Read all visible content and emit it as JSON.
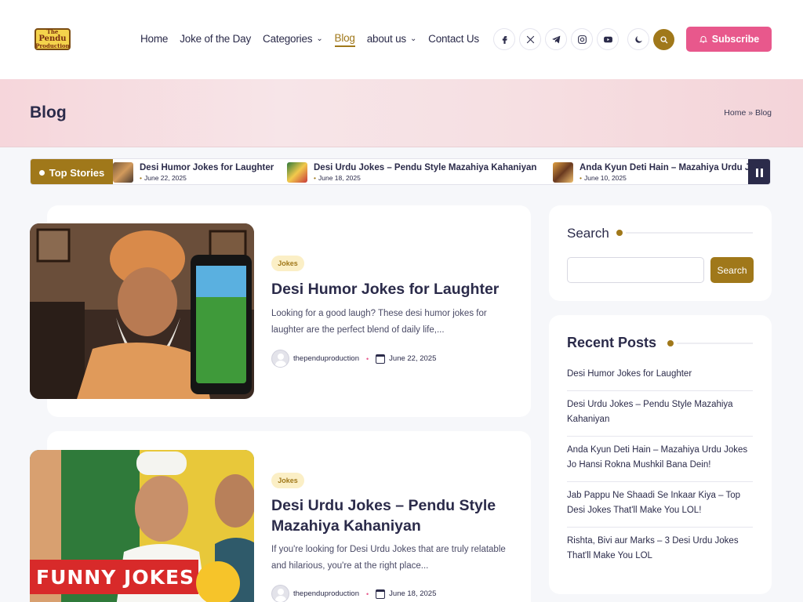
{
  "site": {
    "logo_lines": [
      "The",
      "Pendu",
      "Production"
    ]
  },
  "nav": {
    "items": [
      {
        "label": "Home"
      },
      {
        "label": "Joke of the Day"
      },
      {
        "label": "Categories",
        "dropdown": true
      },
      {
        "label": "Blog",
        "active": true
      },
      {
        "label": "about us",
        "dropdown": true
      },
      {
        "label": "Contact Us"
      }
    ],
    "social_icons": [
      "facebook-icon",
      "x-icon",
      "telegram-icon",
      "instagram-icon",
      "youtube-icon"
    ],
    "subscribe_label": "Subscribe"
  },
  "banner": {
    "title": "Blog",
    "breadcrumb": {
      "home": "Home",
      "separator": "»",
      "current": "Blog"
    }
  },
  "ticker": {
    "label": "Top Stories",
    "items": [
      {
        "title": "Desi Humor Jokes for Laughter",
        "date": "June 22, 2025"
      },
      {
        "title": "Desi Urdu Jokes – Pendu Style Mazahiya Kahaniyan",
        "date": "June 18, 2025"
      },
      {
        "title": "Anda Kyun Deti Hain – Mazahiya Urdu Jokes Jo Hansi Rokna Mushkil Bana Dein!",
        "date": "June 10, 2025"
      }
    ]
  },
  "posts": [
    {
      "category": "Jokes",
      "title": "Desi Humor Jokes for Laughter",
      "excerpt": "Looking for a good laugh? These desi humor jokes for laughter are the perfect blend of daily life,...",
      "author": "thependuproduction",
      "date": "June 22, 2025"
    },
    {
      "category": "Jokes",
      "title": "Desi Urdu Jokes – Pendu Style Mazahiya Kahaniyan",
      "excerpt": "If you're looking for Desi Urdu Jokes that are truly relatable and hilarious, you're at the right place...",
      "author": "thependuproduction",
      "date": "June 18, 2025",
      "image_caption": "FUNNY JOKES"
    }
  ],
  "sidebar": {
    "search": {
      "title": "Search",
      "placeholder": "",
      "button": "Search"
    },
    "recent": {
      "title": "Recent Posts",
      "items": [
        "Desi Humor Jokes for Laughter",
        "Desi Urdu Jokes – Pendu Style Mazahiya Kahaniyan",
        "Anda Kyun Deti Hain – Mazahiya Urdu Jokes Jo Hansi Rokna Mushkil Bana Dein!",
        "Jab Pappu Ne Shaadi Se Inkaar Kiya – Top Desi Jokes That'll Make You LOL!",
        "Rishta, Bivi aur Marks – 3 Desi Urdu Jokes That'll Make You LOL"
      ]
    }
  },
  "colors": {
    "accent": "#a0781a",
    "subscribe": "#e8588c",
    "text": "#2b2b4a"
  }
}
